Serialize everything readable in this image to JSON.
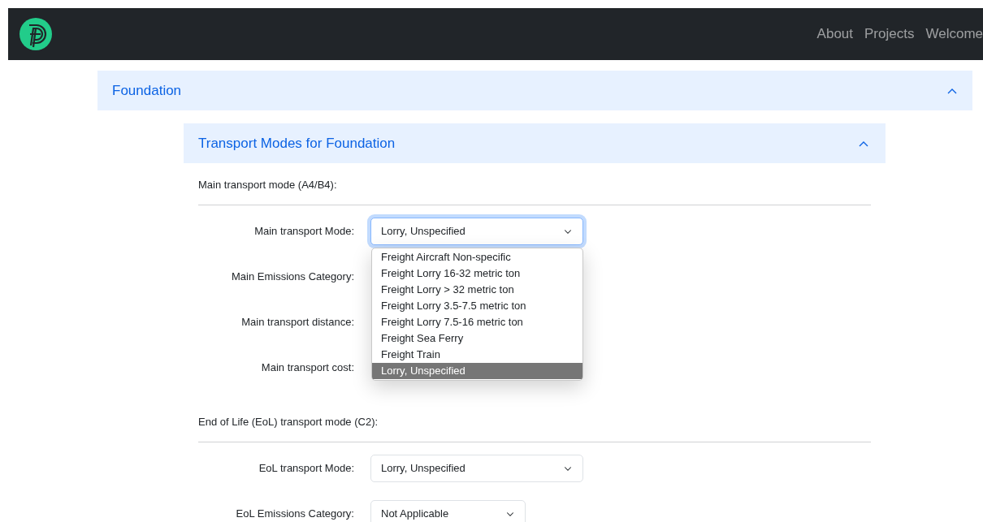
{
  "nav": {
    "links": [
      {
        "label": "About"
      },
      {
        "label": "Projects"
      },
      {
        "label": "Welcome"
      }
    ]
  },
  "accordion": {
    "title": "Foundation",
    "expanded": true,
    "inner": {
      "title": "Transport Modes for Foundation",
      "expanded": true,
      "sections": [
        {
          "heading": "Main transport mode (A4/B4):",
          "fields": [
            {
              "kind": "mode",
              "label": "Main transport Mode:",
              "value": "Lorry, Unspecified",
              "focused": true,
              "options": [
                {
                  "label": "Freight Aircraft Non-specific",
                  "selected": false
                },
                {
                  "label": "Freight Lorry 16-32 metric ton",
                  "selected": false
                },
                {
                  "label": "Freight Lorry > 32 metric ton",
                  "selected": false
                },
                {
                  "label": "Freight Lorry 3.5-7.5 metric ton",
                  "selected": false
                },
                {
                  "label": "Freight Lorry 7.5-16 metric ton",
                  "selected": false
                },
                {
                  "label": "Freight Sea Ferry",
                  "selected": false
                },
                {
                  "label": "Freight Train",
                  "selected": false
                },
                {
                  "label": "Lorry, Unspecified",
                  "selected": true
                }
              ]
            },
            {
              "kind": "emissions",
              "label": "Main Emissions Category:"
            },
            {
              "kind": "distance",
              "label": "Main transport distance:"
            },
            {
              "kind": "cost",
              "label": "Main transport cost:"
            }
          ]
        },
        {
          "heading": "End of Life (EoL) transport mode (C2):",
          "fields": [
            {
              "kind": "mode",
              "label": "EoL transport Mode:",
              "value": "Lorry, Unspecified",
              "focused": false
            },
            {
              "kind": "emissions",
              "label": "EoL Emissions Category:",
              "value": "Not Applicable",
              "focused": false
            }
          ]
        }
      ]
    }
  }
}
